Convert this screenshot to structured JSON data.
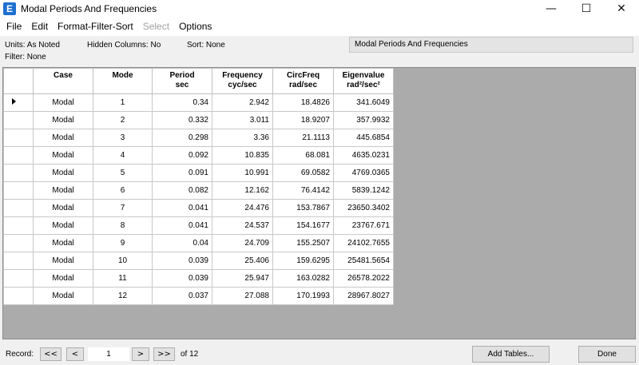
{
  "window": {
    "title": "Modal Periods And Frequencies",
    "app_icon_letter": "E",
    "controls": {
      "minimize": "—",
      "maximize": "☐",
      "close": "✕"
    }
  },
  "menu": {
    "items": [
      {
        "label": "File",
        "enabled": true
      },
      {
        "label": "Edit",
        "enabled": true
      },
      {
        "label": "Format-Filter-Sort",
        "enabled": true
      },
      {
        "label": "Select",
        "enabled": false
      },
      {
        "label": "Options",
        "enabled": true
      }
    ]
  },
  "info": {
    "units": "Units:  As Noted",
    "hidden_columns": "Hidden Columns:  No",
    "sort": "Sort:  None",
    "filter": "Filter:  None",
    "table_caption": "Modal Periods And Frequencies"
  },
  "table": {
    "headers": [
      {
        "line1": "Case",
        "line2": ""
      },
      {
        "line1": "Mode",
        "line2": ""
      },
      {
        "line1": "Period",
        "line2": "sec"
      },
      {
        "line1": "Frequency",
        "line2": "cyc/sec"
      },
      {
        "line1": "CircFreq",
        "line2": "rad/sec"
      },
      {
        "line1": "Eigenvalue",
        "line2": "rad²/sec²"
      }
    ],
    "rows": [
      [
        "Modal",
        "1",
        "0.34",
        "2.942",
        "18.4826",
        "341.6049"
      ],
      [
        "Modal",
        "2",
        "0.332",
        "3.011",
        "18.9207",
        "357.9932"
      ],
      [
        "Modal",
        "3",
        "0.298",
        "3.36",
        "21.1113",
        "445.6854"
      ],
      [
        "Modal",
        "4",
        "0.092",
        "10.835",
        "68.081",
        "4635.0231"
      ],
      [
        "Modal",
        "5",
        "0.091",
        "10.991",
        "69.0582",
        "4769.0365"
      ],
      [
        "Modal",
        "6",
        "0.082",
        "12.162",
        "76.4142",
        "5839.1242"
      ],
      [
        "Modal",
        "7",
        "0.041",
        "24.476",
        "153.7867",
        "23650.3402"
      ],
      [
        "Modal",
        "8",
        "0.041",
        "24.537",
        "154.1677",
        "23767.671"
      ],
      [
        "Modal",
        "9",
        "0.04",
        "24.709",
        "155.2507",
        "24102.7655"
      ],
      [
        "Modal",
        "10",
        "0.039",
        "25.406",
        "159.6295",
        "25481.5654"
      ],
      [
        "Modal",
        "11",
        "0.039",
        "25.947",
        "163.0282",
        "26578.2022"
      ],
      [
        "Modal",
        "12",
        "0.037",
        "27.088",
        "170.1993",
        "28967.8027"
      ]
    ],
    "current_row_index": 0
  },
  "status": {
    "record_label": "Record:",
    "first": "<<",
    "prev": "<",
    "current": "1",
    "next": ">",
    "last": ">>",
    "of_label": "of 12",
    "add_tables": "Add Tables...",
    "done": "Done"
  }
}
